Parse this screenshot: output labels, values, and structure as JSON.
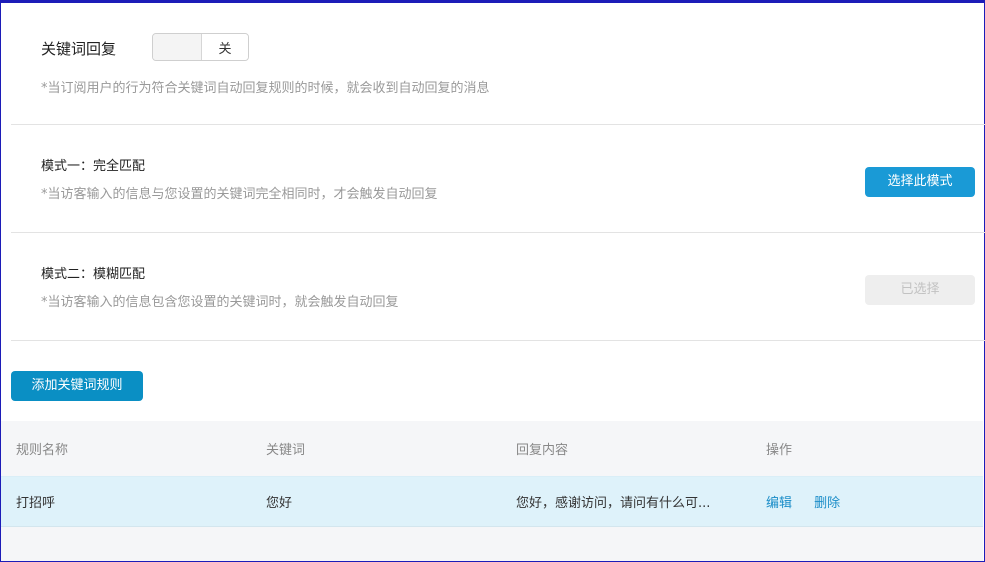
{
  "keyword_reply": {
    "label": "关键词回复",
    "switch_state": "关",
    "hint": "*当订阅用户的行为符合关键词自动回复规则的时候，就会收到自动回复的消息"
  },
  "mode1": {
    "title": "模式一：完全匹配",
    "hint": "*当访客输入的信息与您设置的关键词完全相同时，才会触发自动回复",
    "button": "选择此模式"
  },
  "mode2": {
    "title": "模式二：模糊匹配",
    "hint": "*当访客输入的信息包含您设置的关键词时，就会触发自动回复",
    "button": "已选择"
  },
  "add_rule_button": "添加关键词规则",
  "table": {
    "headers": [
      "规则名称",
      "关键词",
      "回复内容",
      "操作"
    ],
    "rows": [
      {
        "name": "打招呼",
        "keyword": "您好",
        "reply": "您好，感谢访问，请问有什么可...",
        "actions": [
          "编辑",
          "删除"
        ]
      }
    ]
  },
  "colors": {
    "primary": "#1a9ad6",
    "link": "#1a8dc8",
    "row_highlight": "#def2fa"
  }
}
